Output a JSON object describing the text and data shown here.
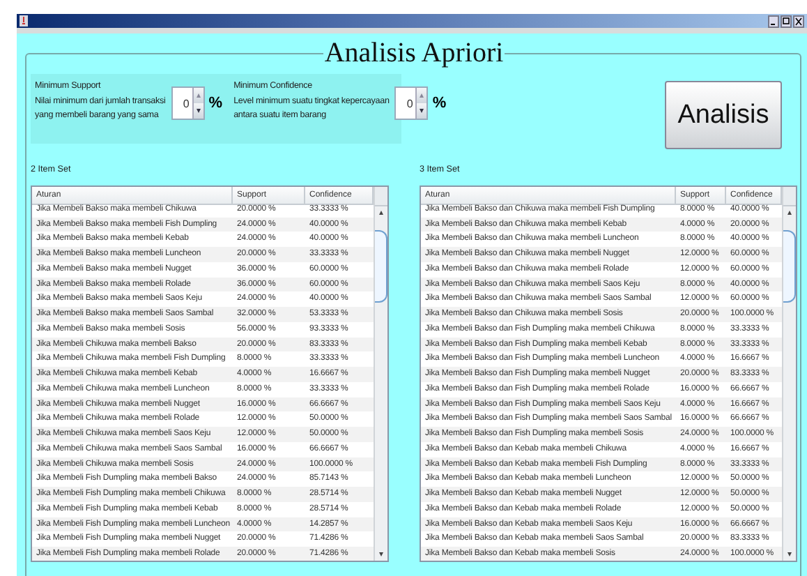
{
  "title": "Analisis Apriori",
  "settings": [
    {
      "label": "Minimum Support",
      "lines": [
        "Nilai minimum dari jumlah transaksi",
        "yang membeli barang yang sama"
      ],
      "value": "0",
      "unit": "%"
    },
    {
      "label": "Minimum Confidence",
      "lines": [
        "Level minimum suatu tingkat kepercayaan",
        "antara suatu item barang"
      ],
      "value": "0",
      "unit": "%"
    }
  ],
  "action_button": "Analisis",
  "tables": [
    {
      "label": "2 Item Set",
      "columns": [
        "Aturan",
        "Support",
        "Confidence"
      ],
      "rows": [
        [
          "Jika Membeli Bakso maka membeli Chikuwa",
          "20.0000 %",
          "33.3333 %"
        ],
        [
          "Jika Membeli Bakso maka membeli Fish Dumpling",
          "24.0000 %",
          "40.0000 %"
        ],
        [
          "Jika Membeli Bakso maka membeli Kebab",
          "24.0000 %",
          "40.0000 %"
        ],
        [
          "Jika Membeli Bakso maka membeli Luncheon",
          "20.0000 %",
          "33.3333 %"
        ],
        [
          "Jika Membeli Bakso maka membeli Nugget",
          "36.0000 %",
          "60.0000 %"
        ],
        [
          "Jika Membeli Bakso maka membeli Rolade",
          "36.0000 %",
          "60.0000 %"
        ],
        [
          "Jika Membeli Bakso maka membeli Saos Keju",
          "24.0000 %",
          "40.0000 %"
        ],
        [
          "Jika Membeli Bakso maka membeli Saos Sambal",
          "32.0000 %",
          "53.3333 %"
        ],
        [
          "Jika Membeli Bakso maka membeli Sosis",
          "56.0000 %",
          "93.3333 %"
        ],
        [
          "Jika Membeli Chikuwa maka membeli Bakso",
          "20.0000 %",
          "83.3333 %"
        ],
        [
          "Jika Membeli Chikuwa maka membeli Fish Dumpling",
          "8.0000 %",
          "33.3333 %"
        ],
        [
          "Jika Membeli Chikuwa maka membeli Kebab",
          "4.0000 %",
          "16.6667 %"
        ],
        [
          "Jika Membeli Chikuwa maka membeli Luncheon",
          "8.0000 %",
          "33.3333 %"
        ],
        [
          "Jika Membeli Chikuwa maka membeli Nugget",
          "16.0000 %",
          "66.6667 %"
        ],
        [
          "Jika Membeli Chikuwa maka membeli Rolade",
          "12.0000 %",
          "50.0000 %"
        ],
        [
          "Jika Membeli Chikuwa maka membeli Saos Keju",
          "12.0000 %",
          "50.0000 %"
        ],
        [
          "Jika Membeli Chikuwa maka membeli Saos Sambal",
          "16.0000 %",
          "66.6667 %"
        ],
        [
          "Jika Membeli Chikuwa maka membeli Sosis",
          "24.0000 %",
          "100.0000 %"
        ],
        [
          "Jika Membeli Fish Dumpling maka membeli Bakso",
          "24.0000 %",
          "85.7143 %"
        ],
        [
          "Jika Membeli Fish Dumpling maka membeli Chikuwa",
          "8.0000 %",
          "28.5714 %"
        ],
        [
          "Jika Membeli Fish Dumpling maka membeli Kebab",
          "8.0000 %",
          "28.5714 %"
        ],
        [
          "Jika Membeli Fish Dumpling maka membeli Luncheon",
          "4.0000 %",
          "14.2857 %"
        ],
        [
          "Jika Membeli Fish Dumpling maka membeli Nugget",
          "20.0000 %",
          "71.4286 %"
        ],
        [
          "Jika Membeli Fish Dumpling maka membeli Rolade",
          "20.0000 %",
          "71.4286 %"
        ]
      ]
    },
    {
      "label": "3 Item Set",
      "columns": [
        "Aturan",
        "Support",
        "Confidence"
      ],
      "rows": [
        [
          "Jika Membeli Bakso dan Chikuwa maka membeli Fish Dumpling",
          "8.0000 %",
          "40.0000 %"
        ],
        [
          "Jika Membeli Bakso dan Chikuwa maka membeli Kebab",
          "4.0000 %",
          "20.0000 %"
        ],
        [
          "Jika Membeli Bakso dan Chikuwa maka membeli Luncheon",
          "8.0000 %",
          "40.0000 %"
        ],
        [
          "Jika Membeli Bakso dan Chikuwa maka membeli Nugget",
          "12.0000 %",
          "60.0000 %"
        ],
        [
          "Jika Membeli Bakso dan Chikuwa maka membeli Rolade",
          "12.0000 %",
          "60.0000 %"
        ],
        [
          "Jika Membeli Bakso dan Chikuwa maka membeli Saos Keju",
          "8.0000 %",
          "40.0000 %"
        ],
        [
          "Jika Membeli Bakso dan Chikuwa maka membeli Saos Sambal",
          "12.0000 %",
          "60.0000 %"
        ],
        [
          "Jika Membeli Bakso dan Chikuwa maka membeli Sosis",
          "20.0000 %",
          "100.0000 %"
        ],
        [
          "Jika Membeli Bakso dan Fish Dumpling maka membeli Chikuwa",
          "8.0000 %",
          "33.3333 %"
        ],
        [
          "Jika Membeli Bakso dan Fish Dumpling maka membeli Kebab",
          "8.0000 %",
          "33.3333 %"
        ],
        [
          "Jika Membeli Bakso dan Fish Dumpling maka membeli Luncheon",
          "4.0000 %",
          "16.6667 %"
        ],
        [
          "Jika Membeli Bakso dan Fish Dumpling maka membeli Nugget",
          "20.0000 %",
          "83.3333 %"
        ],
        [
          "Jika Membeli Bakso dan Fish Dumpling maka membeli Rolade",
          "16.0000 %",
          "66.6667 %"
        ],
        [
          "Jika Membeli Bakso dan Fish Dumpling maka membeli Saos Keju",
          "4.0000 %",
          "16.6667 %"
        ],
        [
          "Jika Membeli Bakso dan Fish Dumpling maka membeli Saos Sambal",
          "16.0000 %",
          "66.6667 %"
        ],
        [
          "Jika Membeli Bakso dan Fish Dumpling maka membeli Sosis",
          "24.0000 %",
          "100.0000 %"
        ],
        [
          "Jika Membeli Bakso dan Kebab maka membeli Chikuwa",
          "4.0000 %",
          "16.6667 %"
        ],
        [
          "Jika Membeli Bakso dan Kebab maka membeli Fish Dumpling",
          "8.0000 %",
          "33.3333 %"
        ],
        [
          "Jika Membeli Bakso dan Kebab maka membeli Luncheon",
          "12.0000 %",
          "50.0000 %"
        ],
        [
          "Jika Membeli Bakso dan Kebab maka membeli Nugget",
          "12.0000 %",
          "50.0000 %"
        ],
        [
          "Jika Membeli Bakso dan Kebab maka membeli Rolade",
          "12.0000 %",
          "50.0000 %"
        ],
        [
          "Jika Membeli Bakso dan Kebab maka membeli Saos Keju",
          "16.0000 %",
          "66.6667 %"
        ],
        [
          "Jika Membeli Bakso dan Kebab maka membeli Saos Sambal",
          "20.0000 %",
          "83.3333 %"
        ],
        [
          "Jika Membeli Bakso dan Kebab maka membeli Sosis",
          "24.0000 %",
          "100.0000 %"
        ]
      ]
    }
  ]
}
